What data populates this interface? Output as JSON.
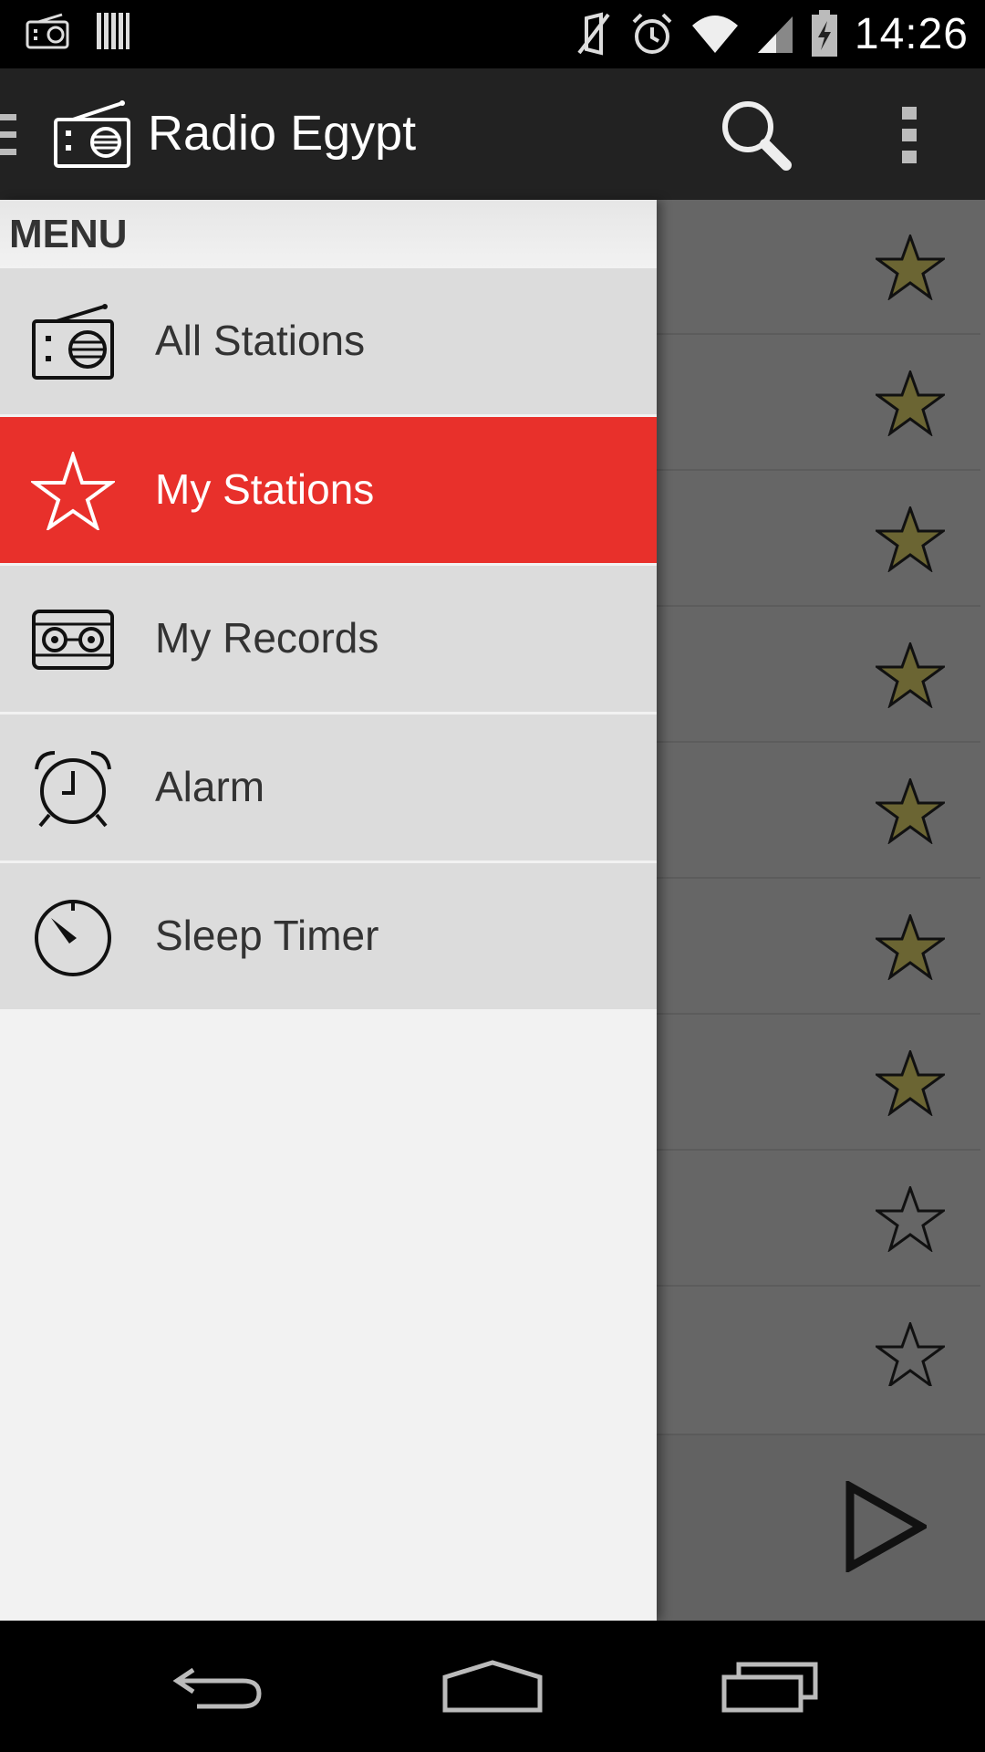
{
  "status_bar": {
    "time": "14:26"
  },
  "app_bar": {
    "title": "Radio Egypt"
  },
  "drawer": {
    "header": "MENU",
    "items": [
      {
        "label": "All Stations",
        "icon": "radio-icon",
        "active": false
      },
      {
        "label": "My Stations",
        "icon": "star-icon",
        "active": true
      },
      {
        "label": "My Records",
        "icon": "cassette-icon",
        "active": false
      },
      {
        "label": "Alarm",
        "icon": "alarm-clock-icon",
        "active": false
      },
      {
        "label": "Sleep Timer",
        "icon": "timer-icon",
        "active": false
      }
    ]
  },
  "favorites": [
    true,
    true,
    true,
    true,
    true,
    true,
    true,
    false,
    false
  ],
  "colors": {
    "accent": "#e8302b",
    "star_fill": "#6b6533",
    "app_bar": "#222222",
    "drawer_bg": "#f2f2f2",
    "menu_item_bg": "#dcdcdc"
  }
}
